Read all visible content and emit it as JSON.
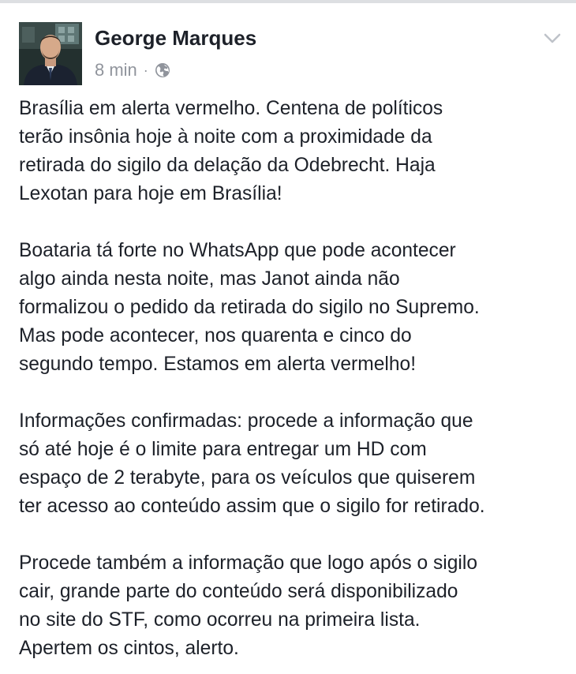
{
  "post": {
    "author": "George Marques",
    "timestamp": "8 min",
    "separator": "·",
    "privacy_icon": "globe-icon",
    "menu_icon": "chevron-down-icon",
    "paragraphs": [
      "Brasília em alerta vermelho. Centena de políticos\nterão insônia hoje à noite com a proximidade da\nretirada do sigilo da delação da Odebrecht. Haja\nLexotan para hoje em Brasília!",
      "Boataria tá forte no WhatsApp que pode acontecer\nalgo ainda nesta noite, mas Janot ainda não\nformalizou o pedido da retirada do sigilo no Supremo.\nMas pode acontecer, nos quarenta e cinco do\nsegundo tempo. Estamos em alerta vermelho!",
      "Informações confirmadas: procede a informação que\nsó até hoje é o limite para entregar um HD com\nespaço de 2 terabyte, para os veículos que quiserem\nter acesso ao conteúdo assim que o sigilo for retirado.",
      "Procede também a informação que logo após o sigilo\ncair, grande parte do conteúdo será disponibilizado\nno site do STF, como ocorreu na primeira lista.\nApertem os cintos, alerto."
    ]
  },
  "colors": {
    "text": "#1d2129",
    "meta": "#90949c",
    "border": "#dddfe2"
  }
}
